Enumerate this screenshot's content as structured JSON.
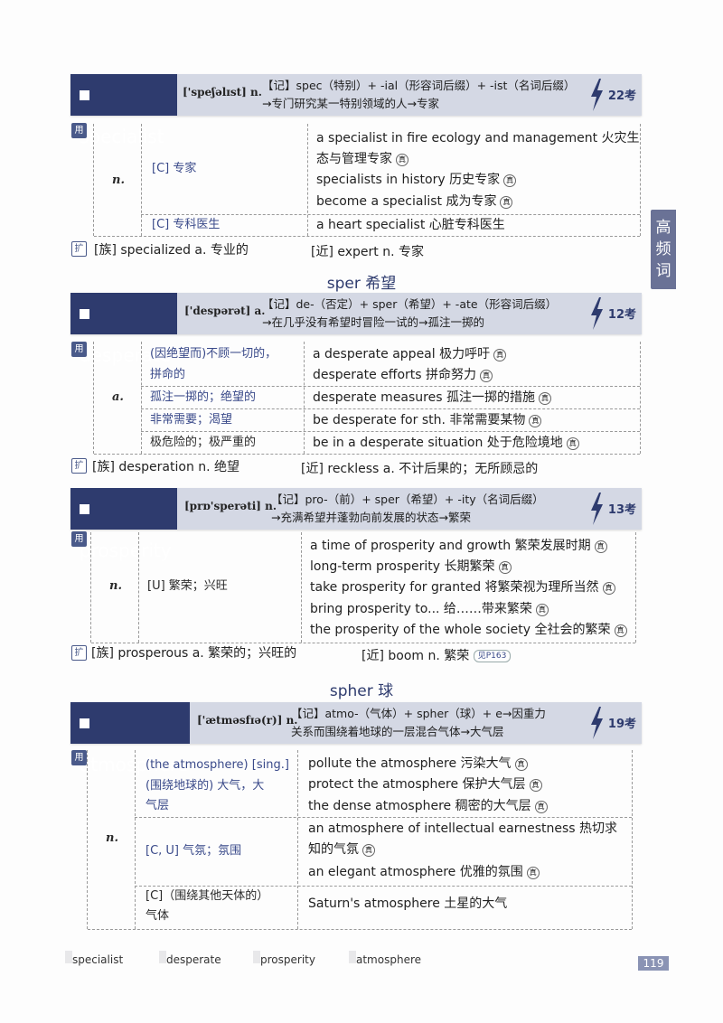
{
  "side_tab": "高频词",
  "entries": [
    {
      "word": "specialist",
      "ipa": "['speʃəlɪst] n.",
      "memo_l1": "【记】spec（特别）+ -ial（形容词后缀）+ -ist（名词后缀）",
      "memo_l2": "→专门研究某一特别领域的人→专家",
      "count": "22考",
      "pos": "n.",
      "senses": [
        "[C] 专家",
        "[C] 专科医生"
      ],
      "examples": [
        "a specialist in fire ecology and management 火灾生",
        "态与管理专家",
        "specialists in history 历史专家",
        "become a specialist 成为专家",
        "a heart specialist 心脏专科医生"
      ],
      "ext_family": "[族] specialized a. 专业的",
      "ext_near": "[近] expert n. 专家"
    },
    {
      "root": "sper 希望",
      "word": "desperate",
      "ipa": "['despərət] a.",
      "memo_l1": "【记】de-（否定）+ sper（希望）+ -ate（形容词后缀）",
      "memo_l2": "→在几乎没有希望时冒险一试的→孤注一掷的",
      "count": "12考",
      "pos": "a.",
      "senses": [
        "(因绝望而)不顾一切的，",
        "拼命的",
        "孤注一掷的；绝望的",
        "非常需要；渴望",
        "极危险的；极严重的"
      ],
      "examples": [
        "a desperate appeal 极力呼吁",
        "desperate efforts 拼命努力",
        "desperate measures 孤注一掷的措施",
        "be desperate for sth. 非常需要某物",
        "be in a desperate situation 处于危险境地"
      ],
      "ext_family": "[族] desperation n. 绝望",
      "ext_near": "[近] reckless a. 不计后果的；无所顾忌的"
    },
    {
      "word": "prosperity",
      "ipa": "[prɒ'sperəti] n.",
      "memo_l1": "【记】pro-（前）+ sper（希望）+ -ity（名词后缀）",
      "memo_l2": "→充满希望并蓬勃向前发展的状态→繁荣",
      "count": "13考",
      "pos": "n.",
      "senses": [
        "[U] 繁荣；兴旺"
      ],
      "examples": [
        "a time of prosperity and growth 繁荣发展时期",
        "long-term prosperity 长期繁荣",
        "take prosperity for granted 将繁荣视为理所当然",
        "bring prosperity to... 给……带来繁荣",
        "the prosperity of the whole society 全社会的繁荣"
      ],
      "ext_family": "[族] prosperous a. 繁荣的；兴旺的",
      "ext_near": "[近] boom n. 繁荣",
      "ext_ref": "见P163"
    },
    {
      "root": "spher 球",
      "word": "atmosphere",
      "ipa": "['ætməsfɪə(r)] n.",
      "memo_l1": "【记】atmo-（气体）+ spher（球）+ e→因重力",
      "memo_l2": "关系而围绕着地球的一层混合气体→大气层",
      "count": "19考",
      "pos": "n.",
      "senses": [
        "(the atmosphere) [sing.]",
        "(围绕地球的) 大气，大",
        "气层",
        "[C, U] 气氛；氛围",
        "[C]（围绕其他天体的）",
        "气体"
      ],
      "examples": [
        "pollute the atmosphere 污染大气",
        "protect the atmosphere 保护大气层",
        "the dense atmosphere 稠密的大气层",
        "an atmosphere of intellectual earnestness 热切求",
        "知的气氛",
        "an elegant atmosphere 优雅的氛围",
        "Saturn's atmosphere 土星的大气"
      ]
    }
  ],
  "footer": [
    "specialist",
    "desperate",
    "prosperity",
    "atmosphere"
  ],
  "page_number": "119",
  "labels": {
    "use": "用",
    "ext": "扩",
    "kao": "真"
  }
}
